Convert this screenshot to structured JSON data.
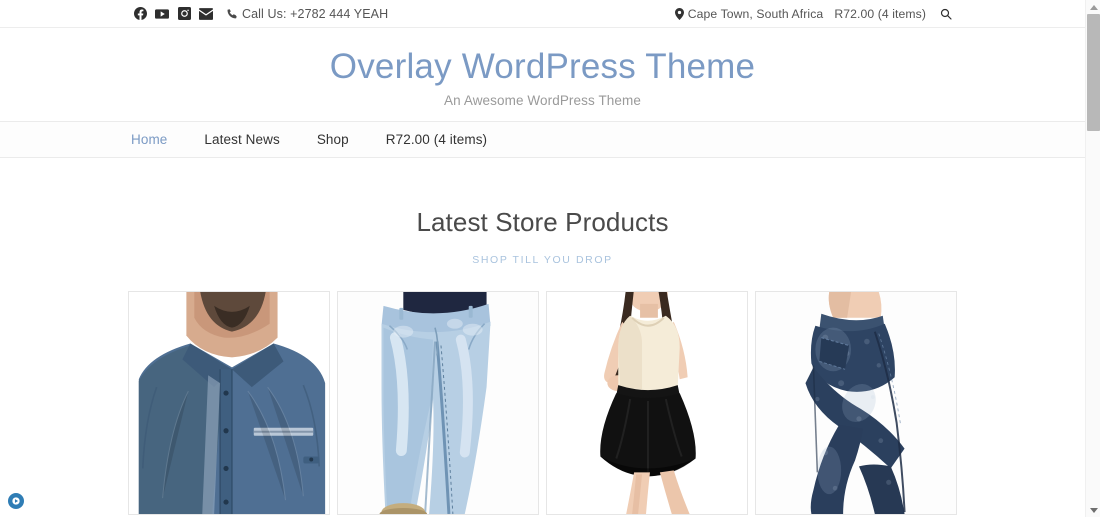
{
  "topbar": {
    "social_links": [
      {
        "name": "facebook-icon",
        "label": "Facebook"
      },
      {
        "name": "youtube-icon",
        "label": "YouTube"
      },
      {
        "name": "instagram-icon",
        "label": "Instagram"
      },
      {
        "name": "email-icon",
        "label": "Email"
      }
    ],
    "phone_icon": "phone-icon",
    "phone_text": "Call Us: +2782 444 YEAH",
    "location_icon": "map-pin-icon",
    "location_text": "Cape Town, South Africa",
    "cart_text": "R72.00 (4 items)",
    "search_icon": "search-icon"
  },
  "branding": {
    "site_title": "Overlay WordPress Theme",
    "tagline": "An Awesome WordPress Theme",
    "title_color": "#7b9ac4",
    "tagline_color": "#9a9a9a"
  },
  "nav": {
    "items": [
      {
        "label": "Home",
        "active": true
      },
      {
        "label": "Latest News",
        "active": false
      },
      {
        "label": "Shop",
        "active": false
      },
      {
        "label": "R72.00 (4 items)",
        "active": false
      }
    ],
    "active_color": "#7b9ac4"
  },
  "section": {
    "title": "Latest Store Products",
    "subtitle": "SHOP TILL YOU DROP",
    "title_color": "#4a4a4a",
    "subtitle_color": "#a9c3de"
  },
  "products": [
    {
      "name": "product-card-mens-blue-shirt",
      "description": "Man wearing a blue denim button-up shirt with chest pocket",
      "alt": "Men's blue denim shirt"
    },
    {
      "name": "product-card-light-blue-jeans",
      "description": "Light wash skinny blue jeans on model",
      "alt": "Light blue skinny jeans"
    },
    {
      "name": "product-card-black-skater-skirt",
      "description": "Woman in cream tank top and black skater skirt",
      "alt": "Black skater skirt outfit"
    },
    {
      "name": "product-card-dark-blue-jeggings",
      "description": "Dark navy blue jeggings on model, side profile",
      "alt": "Dark blue jeggings"
    }
  ],
  "accessibility_widget": {
    "icon": "play-circle-icon",
    "color": "#2f7db5",
    "label": "Accessibility player"
  },
  "scrollbar": {
    "up_arrow": "scroll-up-arrow",
    "down_arrow": "scroll-down-arrow",
    "thumb": "scrollbar-thumb"
  }
}
